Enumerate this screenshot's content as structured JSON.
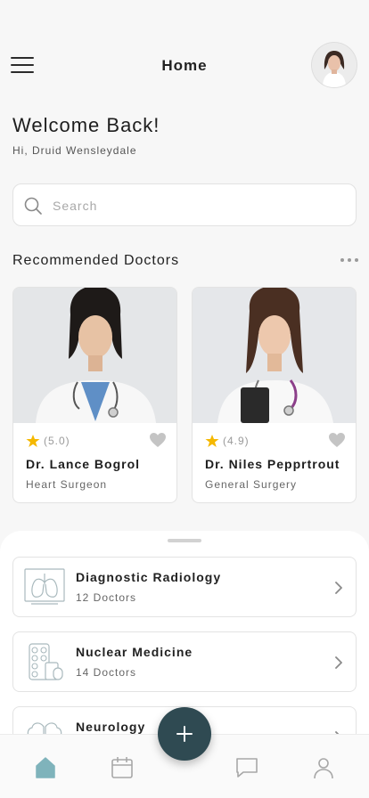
{
  "header": {
    "title": "Home"
  },
  "welcome": {
    "title": "Welcome Back!",
    "greeting": "Hi, Druid Wensleydale"
  },
  "search": {
    "placeholder": "Search"
  },
  "recommended": {
    "title": "Recommended Doctors",
    "doctors": [
      {
        "name": "Dr. Lance Bogrol",
        "specialty": "Heart Surgeon",
        "rating": "(5.0)"
      },
      {
        "name": "Dr. Niles Pepprtrout",
        "specialty": "General Surgery",
        "rating": "(4.9)"
      }
    ]
  },
  "specialties": [
    {
      "name": "Diagnostic Radiology",
      "count": "12 Doctors",
      "icon": "lungs-icon"
    },
    {
      "name": "Nuclear Medicine",
      "count": "14 Doctors",
      "icon": "pills-icon"
    },
    {
      "name": "Neurology",
      "count": "",
      "icon": "brain-icon"
    }
  ],
  "nav": {
    "items": [
      "home-icon",
      "calendar-icon",
      "chat-icon",
      "profile-icon"
    ],
    "active": "home-icon",
    "fab_icon": "plus-icon"
  },
  "colors": {
    "accent": "#2f4a52",
    "active_nav": "#7fb3bb",
    "star": "#f5b800",
    "heart": "#c4c4c4"
  }
}
